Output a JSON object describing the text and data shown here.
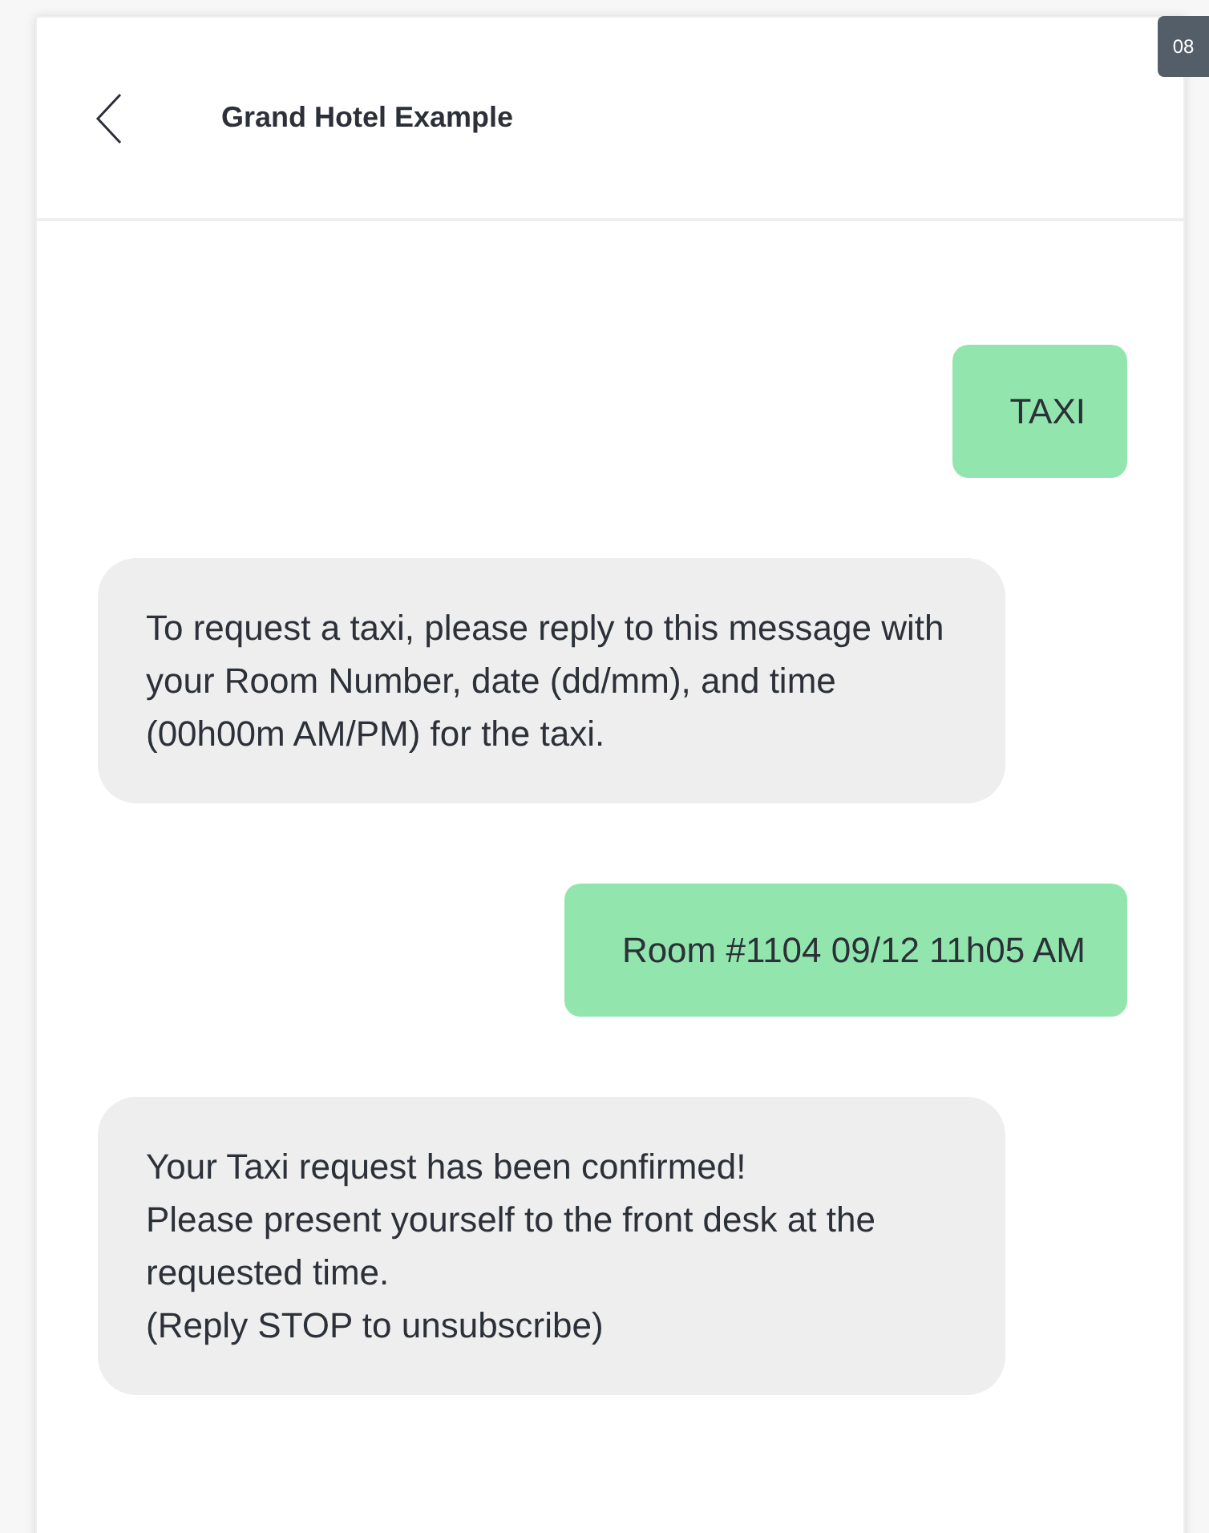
{
  "badge": "08",
  "header": {
    "title": "Grand Hotel Example"
  },
  "messages": [
    {
      "kind": "sent",
      "text": "TAXI"
    },
    {
      "kind": "received",
      "text": "To request a taxi, please reply to this message with your Room Number, date (dd/mm), and time (00h00m AM/PM) for the taxi."
    },
    {
      "kind": "sent",
      "text": "Room #1104 09/12 11h05 AM"
    },
    {
      "kind": "received",
      "text": "Your Taxi request has been confirmed!\nPlease present yourself to the front desk at the requested time.\n(Reply STOP to unsubscribe)"
    }
  ]
}
